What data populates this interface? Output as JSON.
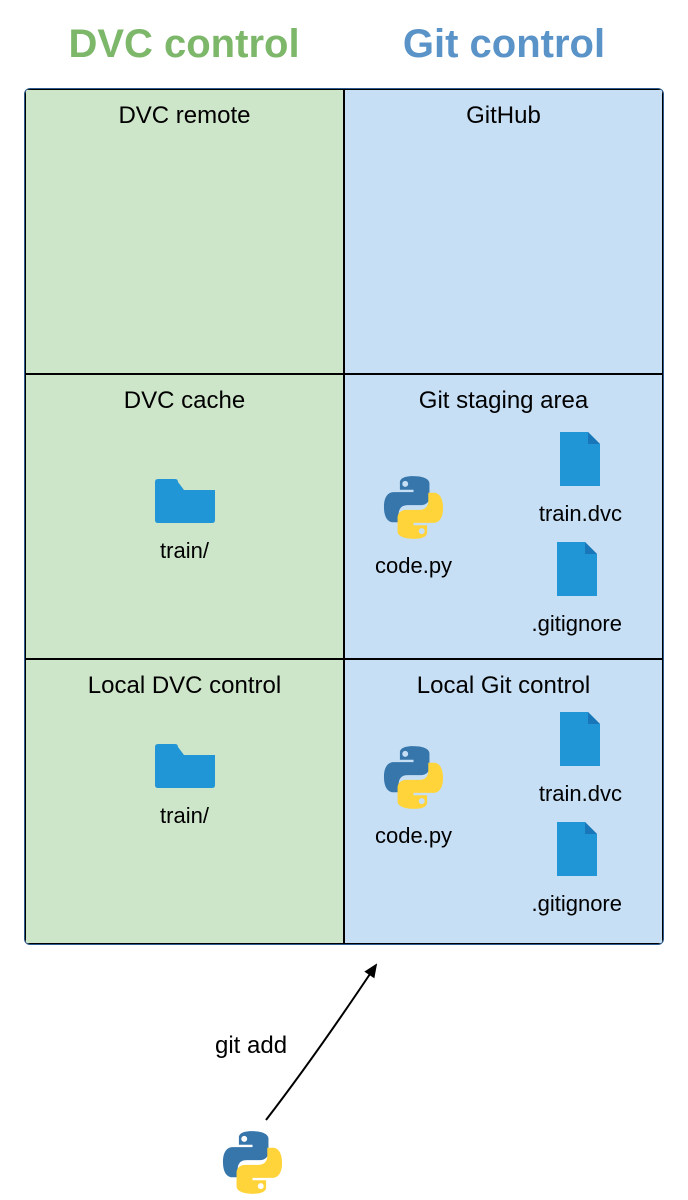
{
  "headers": {
    "dvc": "DVC control",
    "git": "Git control"
  },
  "cells": {
    "dvc_remote": "DVC remote",
    "github": "GitHub",
    "dvc_cache": "DVC cache",
    "git_staging": "Git staging area",
    "local_dvc": "Local DVC control",
    "local_git": "Local Git control"
  },
  "labels": {
    "train_folder": "train/",
    "code_py": "code.py",
    "train_dvc": "train.dvc",
    "gitignore": ".gitignore",
    "git_add": "git add"
  },
  "colors": {
    "dvc_green": "#7cb76a",
    "git_blue": "#5a93c8",
    "dvc_bg": "#cde5c8",
    "git_bg": "#c7dff5",
    "folder_blue": "#2196d6",
    "file_blue": "#2196d6",
    "python_blue": "#3572A5",
    "python_yellow": "#FFD43B"
  }
}
